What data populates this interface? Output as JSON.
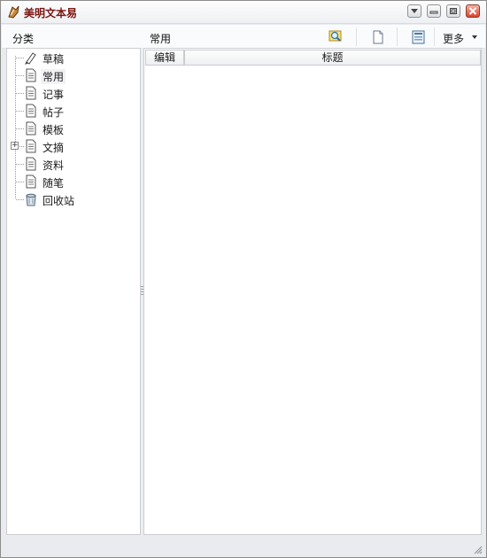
{
  "window": {
    "title": "美明文本易",
    "controls": [
      "menu-icon",
      "minimize-icon",
      "restore-icon",
      "close-icon"
    ]
  },
  "header": {
    "category_label": "分类",
    "current_category": "常用",
    "toolbar": [
      "search-icon",
      "new-document-icon",
      "view-icon"
    ],
    "more_label": "更多"
  },
  "tree": {
    "items": [
      {
        "label": "草稿",
        "icon": "draft-pencil-icon"
      },
      {
        "label": "常用",
        "icon": "document-icon",
        "selected": true
      },
      {
        "label": "记事",
        "icon": "document-icon"
      },
      {
        "label": "帖子",
        "icon": "document-icon"
      },
      {
        "label": "模板",
        "icon": "document-icon"
      },
      {
        "label": "文摘",
        "icon": "document-icon",
        "expandable": true
      },
      {
        "label": "资料",
        "icon": "document-icon"
      },
      {
        "label": "随笔",
        "icon": "document-icon"
      },
      {
        "label": "回收站",
        "icon": "recycle-bin-icon"
      }
    ]
  },
  "list": {
    "columns": [
      "编辑",
      "标题"
    ],
    "rows": []
  },
  "colors": {
    "title_text": "#7a1410",
    "border": "#cbcdd0",
    "chrome": "#e9ebee"
  }
}
